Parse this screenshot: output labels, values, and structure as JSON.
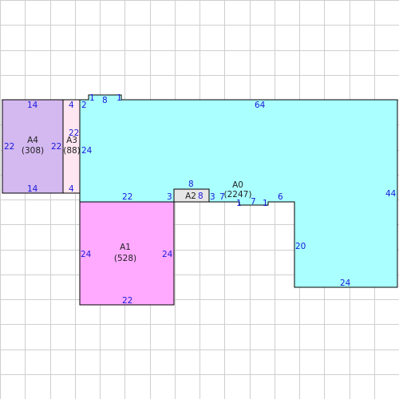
{
  "colors": {
    "grid": "#cfcfcf",
    "outline": "#000000",
    "A0": "#aaffff",
    "A1": "#ffaaff",
    "A2": "#e6e6e6",
    "A3": "#ffe6f0",
    "A4": "#d4b8f0"
  },
  "rooms": {
    "A0": {
      "name": "A0",
      "area": "(2247)"
    },
    "A1": {
      "name": "A1",
      "area": "(528)"
    },
    "A2": {
      "name": "A2",
      "area": ""
    },
    "A3": {
      "name": "A3",
      "area": "(88)"
    },
    "A4": {
      "name": "A4",
      "area": "(308)"
    }
  },
  "dimensions": {
    "a4_top": "14",
    "a4_bottom": "14",
    "a4_left": "22",
    "a4_right": "22",
    "a3_top": "4",
    "a3_bottom": "4",
    "a3_right": "22",
    "a0_step": "2",
    "a0_notch_left": "1",
    "a0_notch_top": "8",
    "a0_notch_right": "1",
    "a0_top": "64",
    "a0_left": "24",
    "a0_right": "44",
    "a0_bottom_left": "22",
    "a0_step_a": "3",
    "a0_step_b": "3",
    "a0_step_c": "7",
    "a0_notch2_left": "1",
    "a0_notch2_bottom": "7",
    "a0_notch2_right": "1",
    "a0_seg": "6",
    "a0_wing": "20",
    "a0_bottom_right": "24",
    "a2_top": "8",
    "a2_right": "8",
    "a1_left": "24",
    "a1_right": "24",
    "a1_bottom": "22"
  }
}
